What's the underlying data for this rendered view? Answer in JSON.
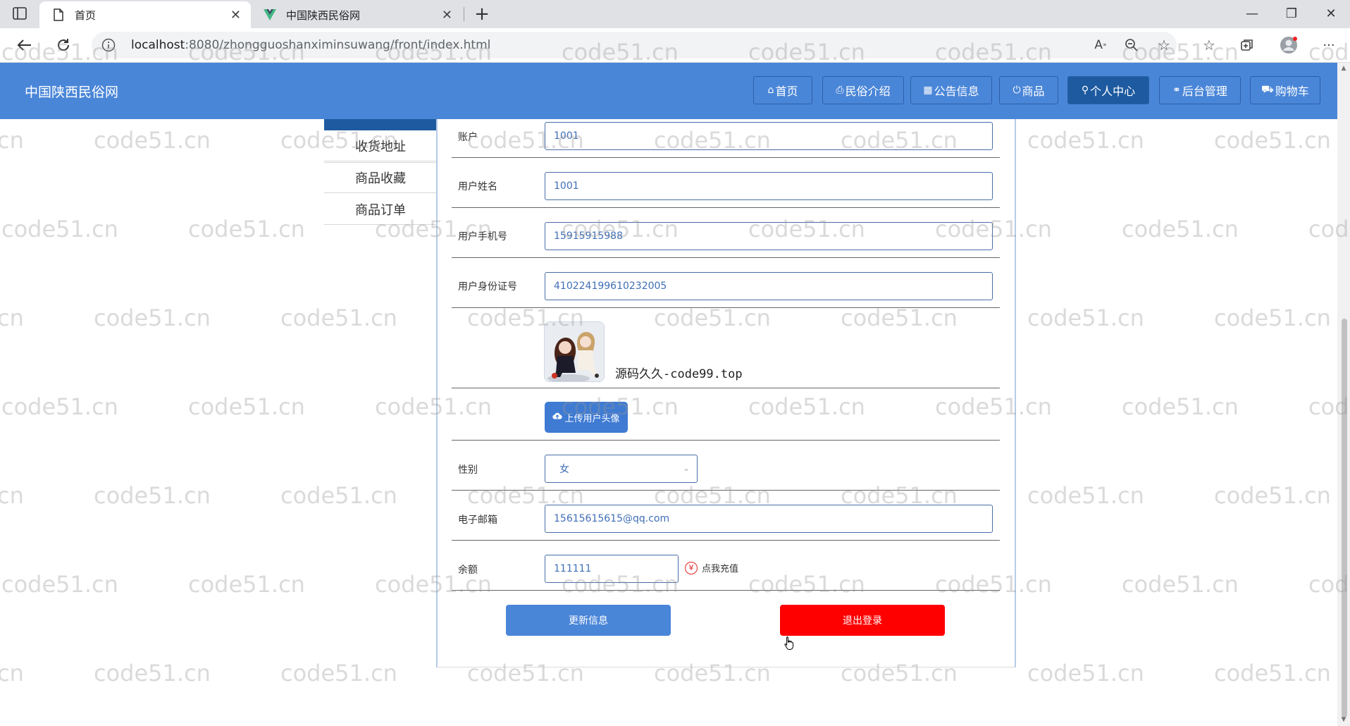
{
  "browser": {
    "tabs": [
      {
        "title": "首页",
        "active": true
      },
      {
        "title": "中国陕西民俗网",
        "active": false
      }
    ],
    "url_host": "localhost",
    "url_rest": ":8080/zhongguoshanximinsuwang/front/index.html"
  },
  "site": {
    "title": "中国陕西民俗网",
    "nav": [
      {
        "icon": "⌂",
        "label": "首页"
      },
      {
        "icon": "⎙",
        "label": "民俗介绍"
      },
      {
        "icon": "▦",
        "label": "公告信息"
      },
      {
        "icon": "⏻",
        "label": "商品"
      },
      {
        "icon": "⚲",
        "label": "个人中心"
      },
      {
        "icon": "⚭",
        "label": "后台管理"
      },
      {
        "icon": "⛟",
        "label": "购物车"
      }
    ]
  },
  "sidebar": {
    "items": [
      "收货地址",
      "商品收藏",
      "商品订单"
    ]
  },
  "form": {
    "account": {
      "label": "账户",
      "value": "1001"
    },
    "name": {
      "label": "用户姓名",
      "value": "1001"
    },
    "phone": {
      "label": "用户手机号",
      "value": "15915915988"
    },
    "id_card": {
      "label": "用户身份证号",
      "value": "410224199610232005"
    },
    "avatar_caption": "源码久久-code99.top",
    "upload_label": "上传用户头像",
    "gender": {
      "label": "性别",
      "value": "女"
    },
    "email": {
      "label": "电子邮箱",
      "value": "15615615615@qq.com"
    },
    "balance": {
      "label": "余额",
      "value": "111111"
    },
    "recharge_label": "点我充值",
    "update_label": "更新信息",
    "logout_label": "退出登录"
  },
  "watermark": "code51.cn",
  "colors": {
    "header": "#4a86d8",
    "active_nav": "#1d5aa0",
    "logout": "#ff0000"
  }
}
